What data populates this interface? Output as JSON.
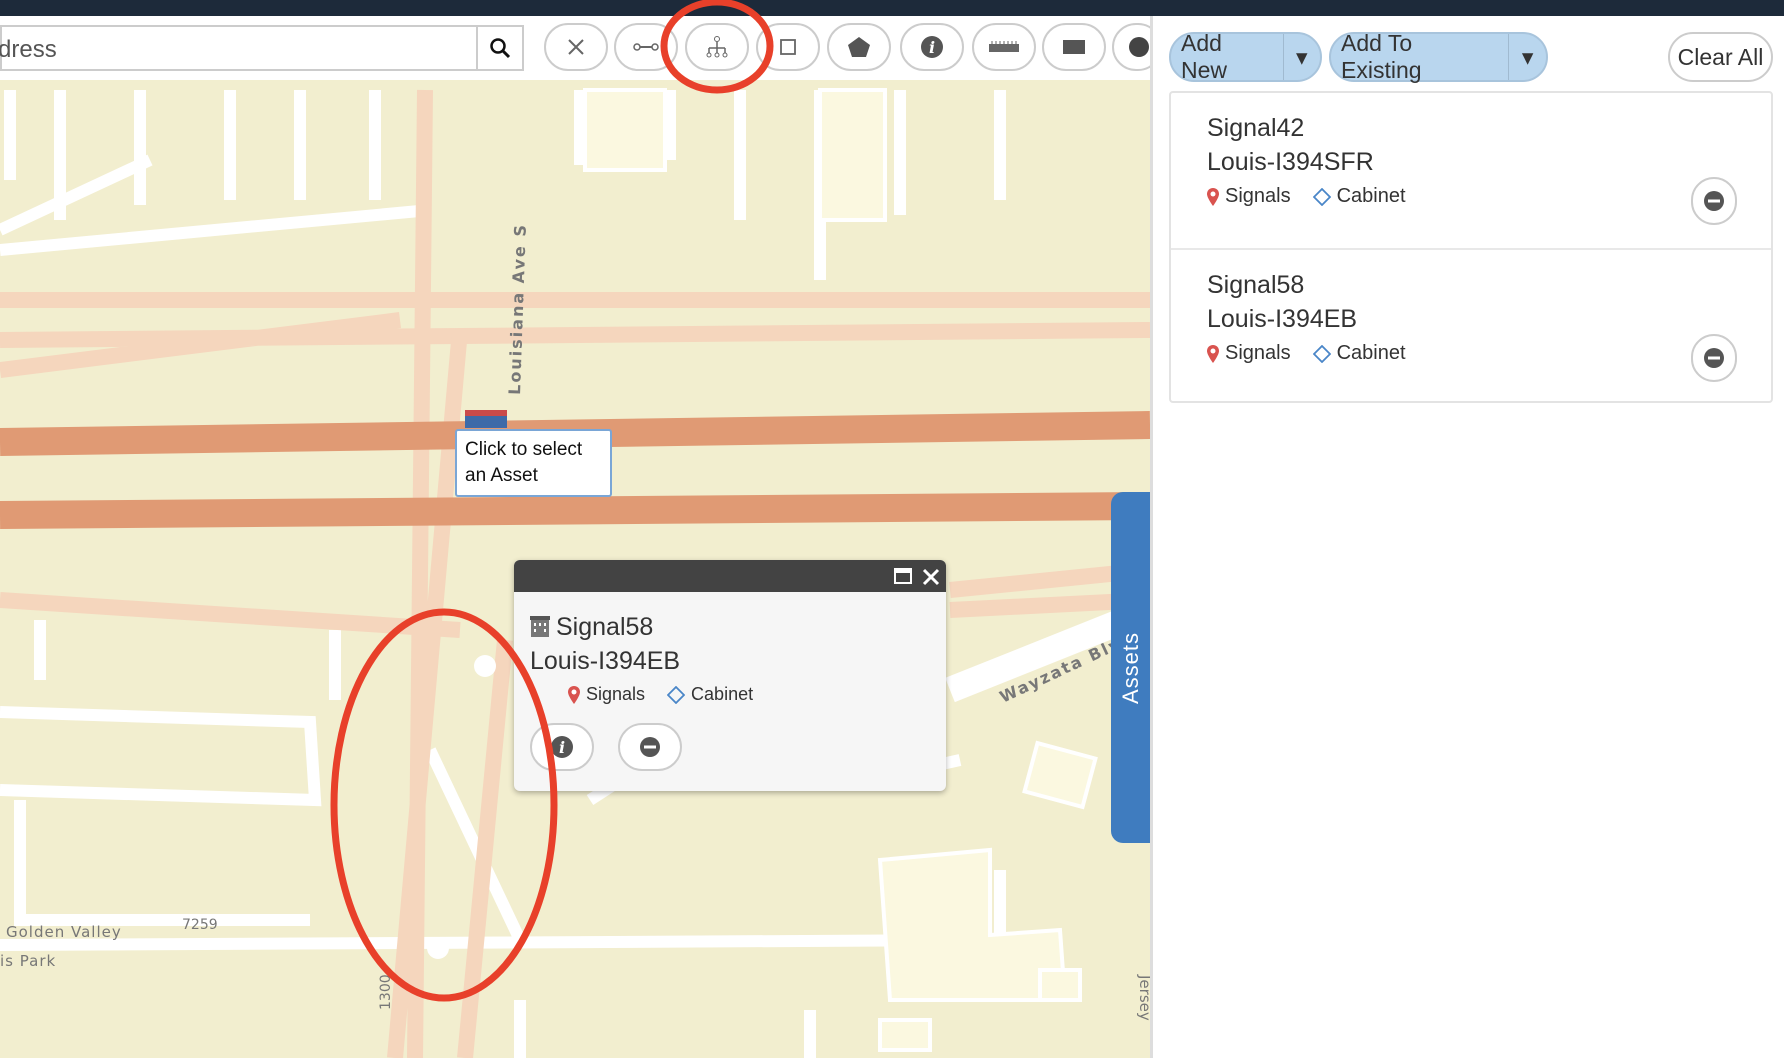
{
  "search": {
    "value": "dress"
  },
  "toolbar": {
    "tools": [
      "close-tool",
      "line-tool",
      "network-trace-tool",
      "rectangle-tool",
      "polygon-tool",
      "info-tool",
      "measure-tool",
      "fill-rect-tool",
      "circle-tool"
    ],
    "highlighted": "network-trace-tool"
  },
  "map": {
    "street_labels": {
      "louisiana": "Louisiana Ave S",
      "wayzata": "Wayzata Blv",
      "golden_valley": "Golden Valley",
      "park": "is Park",
      "num1": "7259",
      "num2": "1300",
      "jersey": "Jersey"
    },
    "tooltip": {
      "line1": "Click to select",
      "line2": "an Asset"
    },
    "popup": {
      "name": "Signal58",
      "location": "Louis-I394EB",
      "layer": "Signals",
      "type": "Cabinet"
    }
  },
  "panel": {
    "add_new": "Add New",
    "add_existing": "Add To Existing",
    "clear_all": "Clear All",
    "items": [
      {
        "name": "Signal42",
        "location": "Louis-I394SFR",
        "layer": "Signals",
        "type": "Cabinet"
      },
      {
        "name": "Signal58",
        "location": "Louis-I394EB",
        "layer": "Signals",
        "type": "Cabinet"
      }
    ],
    "tab": "Assets"
  },
  "colors": {
    "highway": "#e09a74",
    "accent": "#3f7cbf",
    "annotation": "#e8402a",
    "button_blue": "#b9d6ee"
  }
}
